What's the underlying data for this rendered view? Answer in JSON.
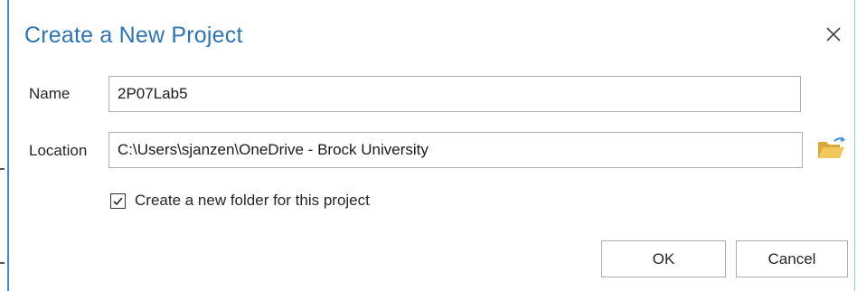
{
  "dialog": {
    "title": "Create a New Project",
    "close_icon": "close-icon"
  },
  "form": {
    "name_label": "Name",
    "name_value": "2P07Lab5",
    "location_label": "Location",
    "location_value": "C:\\Users\\sjanzen\\OneDrive - Brock University",
    "browse_icon": "folder-open-icon",
    "create_folder_label": "Create a new folder for this project",
    "create_folder_checked": true
  },
  "buttons": {
    "ok_label": "OK",
    "cancel_label": "Cancel"
  },
  "colors": {
    "title": "#2e74b5",
    "accent_border": "#3c8fd6",
    "folder": "#e8b84a"
  }
}
